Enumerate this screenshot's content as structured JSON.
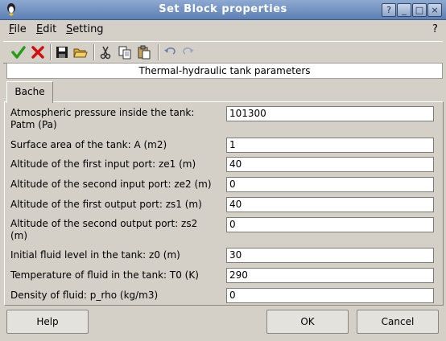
{
  "window": {
    "title": "Set Block properties",
    "controls": [
      "?",
      "_",
      "□",
      "×"
    ]
  },
  "menu": {
    "file": "File",
    "edit": "Edit",
    "setting": "Setting",
    "help": "?"
  },
  "toolbar": {
    "icons": [
      "ok-check-icon",
      "cancel-x-icon",
      "save-icon",
      "open-folder-icon",
      "cut-icon",
      "copy-icon",
      "paste-icon",
      "undo-icon",
      "redo-icon"
    ]
  },
  "header": {
    "text": "Thermal-hydraulic tank parameters"
  },
  "tab": {
    "label": "Bache"
  },
  "params": [
    {
      "label_line1": "Atmospheric pressure inside the tank:",
      "label_line2": "Patm (Pa)",
      "value": "101300"
    },
    {
      "label_line1": "Surface area of the tank: A (m2)",
      "label_line2": "",
      "value": "1"
    },
    {
      "label_line1": "Altitude of the first input port: ze1 (m)",
      "label_line2": "",
      "value": "40"
    },
    {
      "label_line1": "Altitude of the second input port: ze2 (m)",
      "label_line2": "",
      "value": "0"
    },
    {
      "label_line1": "Altitude of the first output port: zs1 (m)",
      "label_line2": "",
      "value": "40"
    },
    {
      "label_line1": "Altitude of the second output port: zs2",
      "label_line2": "(m)",
      "value": "0"
    },
    {
      "label_line1": "Initial fluid level in the tank: z0 (m)",
      "label_line2": "",
      "value": "30"
    },
    {
      "label_line1": "Temperature of fluid in the tank: T0 (K)",
      "label_line2": "",
      "value": "290"
    },
    {
      "label_line1": "Density of fluid: p_rho (kg/m3)",
      "label_line2": "",
      "value": "0"
    }
  ],
  "buttons": {
    "help": "Help",
    "ok": "OK",
    "cancel": "Cancel"
  },
  "colors": {
    "titlebar": "#5d7fb3",
    "ok_check": "#2a9a1a",
    "cancel_x": "#d01010"
  }
}
